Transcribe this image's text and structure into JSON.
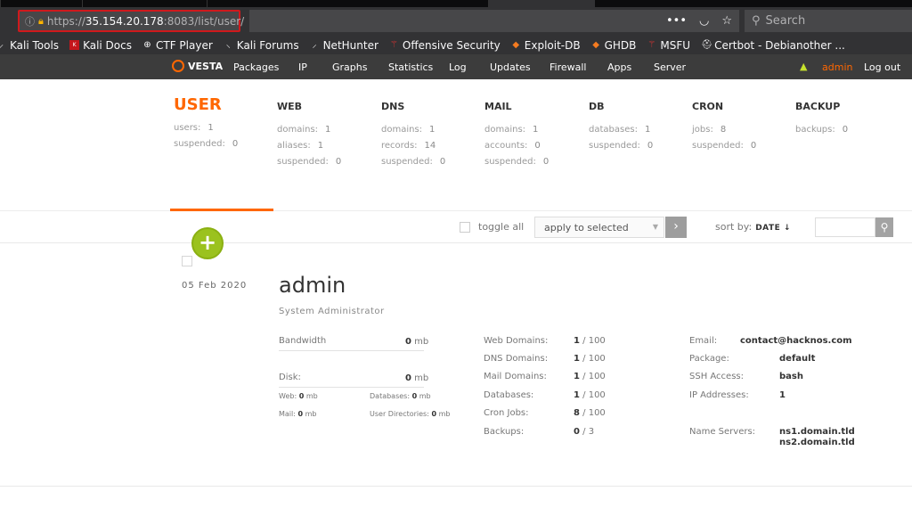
{
  "browser": {
    "url_scheme": "https://",
    "url_host": "35.154.20.178",
    "url_rest": ":8083/list/user/",
    "search_placeholder": "Search",
    "menu_dots": "•••"
  },
  "bookmarks": [
    {
      "label": "Kali Tools",
      "icon": "kali-dragon-icon"
    },
    {
      "label": "Kali Docs",
      "icon": "red-book-icon"
    },
    {
      "label": "CTF Player",
      "icon": "globe-icon"
    },
    {
      "label": "Kali Forums",
      "icon": "kali-dragon-icon"
    },
    {
      "label": "NetHunter",
      "icon": "kali-dragon-icon"
    },
    {
      "label": "Offensive Security",
      "icon": "offsec-icon"
    },
    {
      "label": "Exploit-DB",
      "icon": "exploitdb-icon"
    },
    {
      "label": "GHDB",
      "icon": "exploitdb-icon"
    },
    {
      "label": "MSFU",
      "icon": "offsec-icon"
    },
    {
      "label": "Certbot - Debianother ...",
      "icon": "certbot-icon"
    }
  ],
  "nav": {
    "logo": "VESTA",
    "items": [
      "Packages",
      "IP",
      "Graphs",
      "Statistics",
      "Log",
      "Updates",
      "Firewall",
      "Apps",
      "Server"
    ],
    "user": "admin",
    "logout": "Log out"
  },
  "stats": {
    "user": {
      "title": "USER",
      "rows": [
        {
          "k": "users:",
          "v": "1"
        },
        {
          "k": "suspended:",
          "v": "0"
        }
      ]
    },
    "web": {
      "title": "WEB",
      "rows": [
        {
          "k": "domains:",
          "v": "1"
        },
        {
          "k": "aliases:",
          "v": "1"
        },
        {
          "k": "suspended:",
          "v": "0"
        }
      ]
    },
    "dns": {
      "title": "DNS",
      "rows": [
        {
          "k": "domains:",
          "v": "1"
        },
        {
          "k": "records:",
          "v": "14"
        },
        {
          "k": "suspended:",
          "v": "0"
        }
      ]
    },
    "mail": {
      "title": "MAIL",
      "rows": [
        {
          "k": "domains:",
          "v": "1"
        },
        {
          "k": "accounts:",
          "v": "0"
        },
        {
          "k": "suspended:",
          "v": "0"
        }
      ]
    },
    "db": {
      "title": "DB",
      "rows": [
        {
          "k": "databases:",
          "v": "1"
        },
        {
          "k": "suspended:",
          "v": "0"
        }
      ]
    },
    "cron": {
      "title": "CRON",
      "rows": [
        {
          "k": "jobs:",
          "v": "8"
        },
        {
          "k": "suspended:",
          "v": "0"
        }
      ]
    },
    "backup": {
      "title": "BACKUP",
      "rows": [
        {
          "k": "backups:",
          "v": "0"
        }
      ]
    }
  },
  "toolbar": {
    "toggle_all": "toggle all",
    "apply_selected": "apply to selected",
    "sort_by": "sort by:",
    "sort_field": "DATE ↓"
  },
  "user_row": {
    "date": "05 Feb 2020",
    "name": "admin",
    "role": "System Administrator",
    "bandwidth_label": "Bandwidth",
    "bandwidth_value": "0",
    "disk_label": "Disk:",
    "disk_value": "0",
    "unit": "mb",
    "web_label": "Web:",
    "web_value": "0",
    "databases_label": "Databases:",
    "databases_value": "0",
    "mail_label": "Mail:",
    "mail_value": "0",
    "userdirs_label": "User Directories:",
    "userdirs_value": "0",
    "limits": [
      {
        "label": "Web Domains:",
        "used": "1",
        "max": "100"
      },
      {
        "label": "DNS Domains:",
        "used": "1",
        "max": "100"
      },
      {
        "label": "Mail Domains:",
        "used": "1",
        "max": "100"
      },
      {
        "label": "Databases:",
        "used": "1",
        "max": "100"
      },
      {
        "label": "Cron Jobs:",
        "used": "8",
        "max": "100"
      },
      {
        "label": "Backups:",
        "used": "0",
        "max": "3"
      }
    ],
    "email_label": "Email:",
    "email": "contact@hacknos.com",
    "package_label": "Package:",
    "package": "default",
    "ssh_label": "SSH Access:",
    "ssh": "bash",
    "ip_label": "IP Addresses:",
    "ip": "1",
    "ns_label": "Name Servers:",
    "ns1": "ns1.domain.tld",
    "ns2": "ns2.domain.tld"
  },
  "colors": {
    "accent": "#ff6701",
    "add_button": "#9bc21e",
    "url_highlight": "#d0191c"
  }
}
